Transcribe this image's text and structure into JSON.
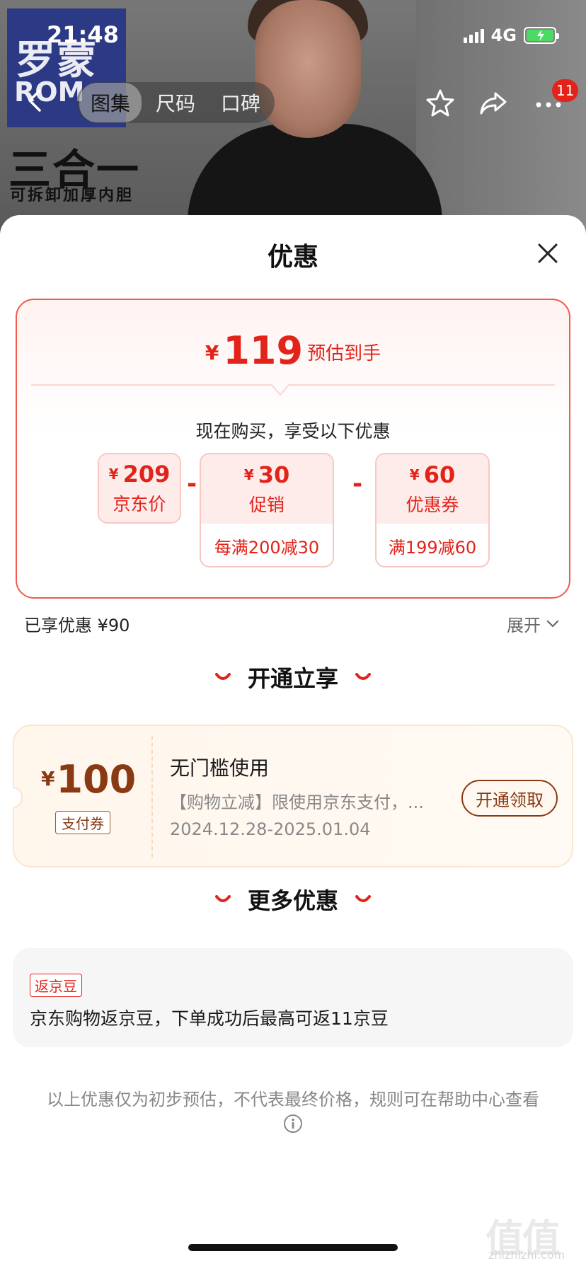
{
  "status_bar": {
    "time": "21:48",
    "network": "4G"
  },
  "hero": {
    "brand_cn": "罗蒙",
    "brand_en": "ROM",
    "title": "三合一",
    "subtitle": "可拆卸加厚内胆"
  },
  "nav": {
    "tabs": [
      "图集",
      "尺码",
      "口碑"
    ],
    "active_tab": 0,
    "cart_badge": "11"
  },
  "sheet": {
    "title": "优惠"
  },
  "estimate": {
    "currency": "¥",
    "amount": "119",
    "label": "预估到手",
    "intro": "现在购买，享受以下优惠",
    "breakdown": [
      {
        "currency": "¥",
        "value": "209",
        "label": "京东价",
        "note": ""
      },
      {
        "currency": "¥",
        "value": "30",
        "label": "促销",
        "note": "每满200减30"
      },
      {
        "currency": "¥",
        "value": "60",
        "label": "优惠券",
        "note": "满199减60"
      }
    ],
    "operator": "-"
  },
  "enjoyed": {
    "text": "已享优惠 ¥90",
    "expand_label": "展开"
  },
  "open_section": {
    "title": "开通立享",
    "coupon": {
      "currency": "¥",
      "amount": "100",
      "tag": "支付券",
      "title": "无门槛使用",
      "desc": "【购物立减】限使用京东支付，...",
      "date": "2024.12.28-2025.01.04",
      "button": "开通领取"
    }
  },
  "more_section": {
    "title": "更多优惠",
    "tag": "返京豆",
    "text": "京东购物返京豆，下单成功后最高可返11京豆"
  },
  "footer": {
    "note": "以上优惠仅为初步预估，不代表最终价格，规则可在帮助中心查看"
  },
  "watermark": {
    "main": "值值值",
    "sub": "zhizhizhi.com"
  },
  "colors": {
    "accent_red": "#e2231a",
    "coupon_brown": "#8a3a12",
    "card_border": "#f05a4f"
  }
}
